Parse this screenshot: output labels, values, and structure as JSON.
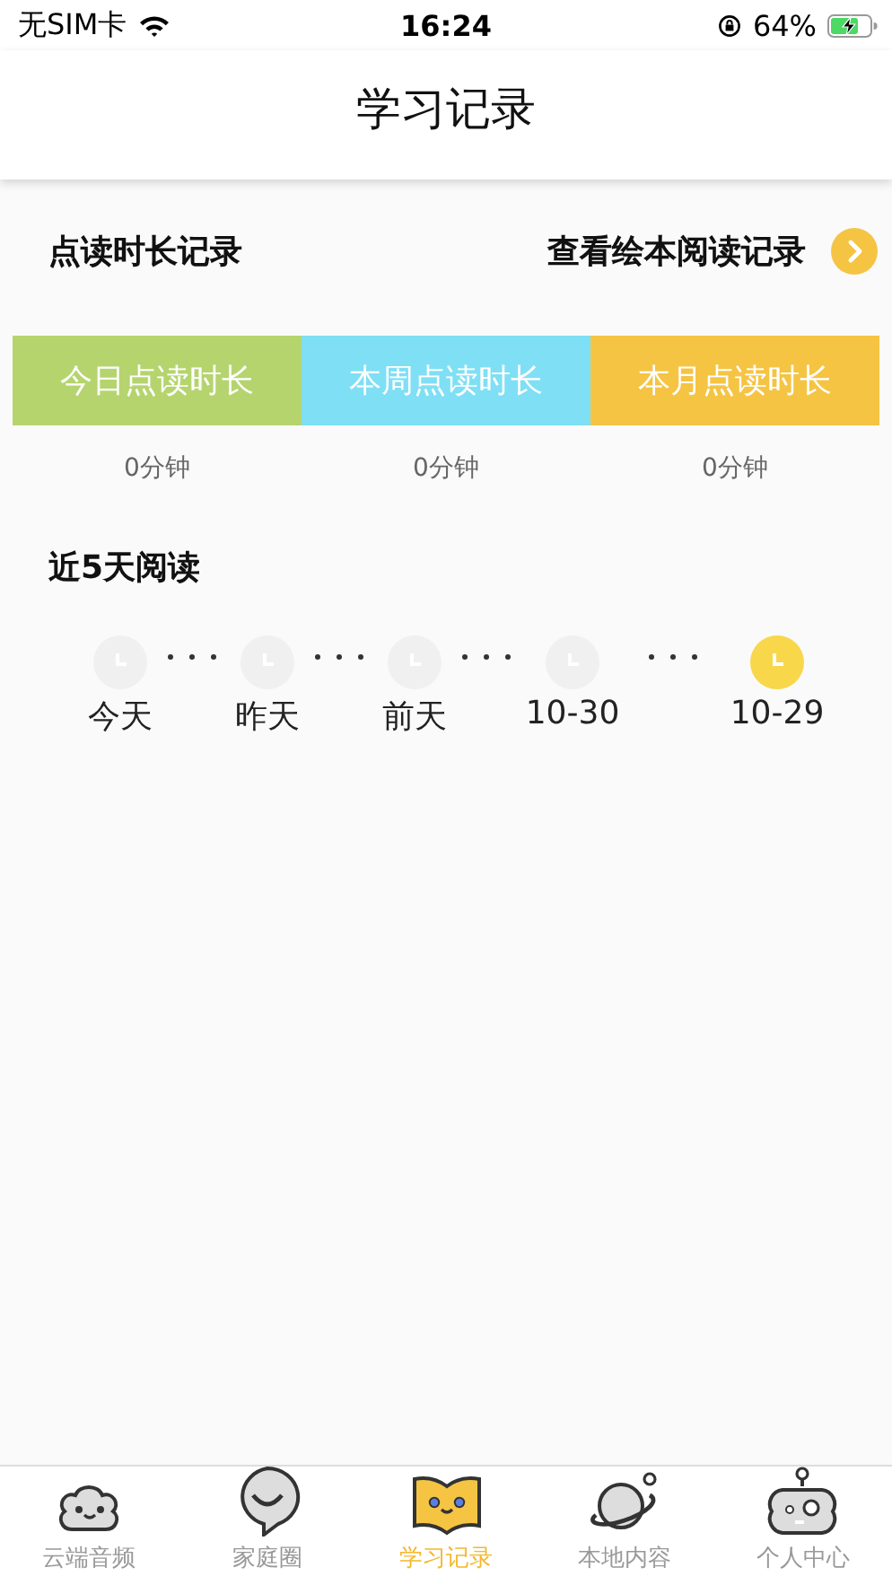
{
  "status_bar": {
    "carrier": "无SIM卡",
    "time": "16:24",
    "battery": "64%"
  },
  "header": {
    "title": "学习记录"
  },
  "section": {
    "title": "点读时长记录",
    "link": "查看绘本阅读记录"
  },
  "durations": [
    {
      "label": "今日点读时长",
      "value": "0分钟",
      "color": "#b5d46e"
    },
    {
      "label": "本周点读时长",
      "value": "0分钟",
      "color": "#7fdff5"
    },
    {
      "label": "本月点读时长",
      "value": "0分钟",
      "color": "#f5c443"
    }
  ],
  "recent": {
    "title": "近5天阅读",
    "days": [
      {
        "label": "今天",
        "read": false
      },
      {
        "label": "昨天",
        "read": false
      },
      {
        "label": "前天",
        "read": false
      },
      {
        "label": "10-30",
        "read": false
      },
      {
        "label": "10-29",
        "read": true
      }
    ]
  },
  "tabs": [
    {
      "label": "云端音频",
      "kind": "cloud",
      "selected": false
    },
    {
      "label": "家庭圈",
      "kind": "bubble",
      "selected": false
    },
    {
      "label": "学习记录",
      "kind": "book",
      "selected": true
    },
    {
      "label": "本地内容",
      "kind": "planet",
      "selected": false
    },
    {
      "label": "个人中心",
      "kind": "robot",
      "selected": false
    }
  ]
}
